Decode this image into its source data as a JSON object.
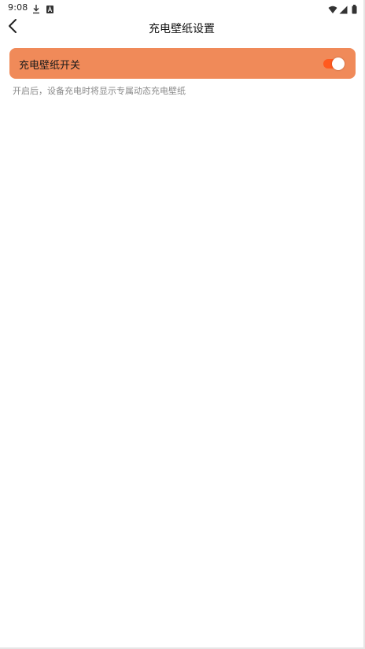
{
  "status_bar": {
    "time": "9:08",
    "icons": [
      "download-icon",
      "a-notification-icon",
      "wifi-icon",
      "signal-icon",
      "battery-icon"
    ]
  },
  "header": {
    "back_icon": "chevron-left-icon",
    "title": "充电壁纸设置"
  },
  "setting": {
    "label": "充电壁纸开关",
    "toggle_on": true,
    "hint": "开启后，设备充电时将显示专属动态充电壁纸"
  },
  "colors": {
    "card_background": "#f08a59",
    "toggle_track": "#ff5a1f",
    "toggle_knob": "#ffffff",
    "hint_text": "#8a8a8a"
  }
}
